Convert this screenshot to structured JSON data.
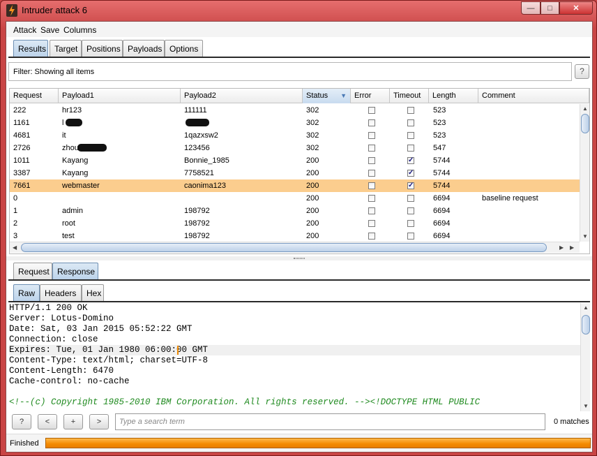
{
  "window": {
    "title": "Intruder attack 6",
    "minimize": "—",
    "maximize": "□",
    "close": "✕"
  },
  "menu": [
    "Attack",
    "Save",
    "Columns"
  ],
  "main_tabs": [
    {
      "label": "Results",
      "active": true
    },
    {
      "label": "Target"
    },
    {
      "label": "Positions"
    },
    {
      "label": "Payloads"
    },
    {
      "label": "Options"
    }
  ],
  "filter": {
    "text": "Filter:  Showing all items",
    "help": "?"
  },
  "table": {
    "columns": [
      "Request",
      "Payload1",
      "Payload2",
      "Status",
      "Error",
      "Timeout",
      "Length",
      "Comment"
    ],
    "sorted_column": "Status",
    "rows": [
      {
        "request": "222",
        "payload1": "hr123",
        "payload2": "111111",
        "status": "302",
        "error": false,
        "timeout": false,
        "length": "523",
        "comment": ""
      },
      {
        "request": "1161",
        "payload1": "l",
        "payload2": "",
        "status": "302",
        "error": false,
        "timeout": false,
        "length": "523",
        "comment": "",
        "redacted": true
      },
      {
        "request": "4681",
        "payload1": "it",
        "payload2": "1qazxsw2",
        "status": "302",
        "error": false,
        "timeout": false,
        "length": "523",
        "comment": ""
      },
      {
        "request": "2726",
        "payload1": "zhou",
        "payload2": "123456",
        "status": "302",
        "error": false,
        "timeout": false,
        "length": "547",
        "comment": "",
        "redacted": true
      },
      {
        "request": "1011",
        "payload1": "Kayang",
        "payload2": "Bonnie_1985",
        "status": "200",
        "error": false,
        "timeout": true,
        "length": "5744",
        "comment": ""
      },
      {
        "request": "3387",
        "payload1": "Kayang",
        "payload2": "7758521",
        "status": "200",
        "error": false,
        "timeout": true,
        "length": "5744",
        "comment": ""
      },
      {
        "request": "7661",
        "payload1": "webmaster",
        "payload2": "caonima123",
        "status": "200",
        "error": false,
        "timeout": true,
        "length": "5744",
        "comment": "",
        "selected": true
      },
      {
        "request": "0",
        "payload1": "",
        "payload2": "",
        "status": "200",
        "error": false,
        "timeout": false,
        "length": "6694",
        "comment": "baseline request"
      },
      {
        "request": "1",
        "payload1": "admin",
        "payload2": "198792",
        "status": "200",
        "error": false,
        "timeout": false,
        "length": "6694",
        "comment": ""
      },
      {
        "request": "2",
        "payload1": "root",
        "payload2": "198792",
        "status": "200",
        "error": false,
        "timeout": false,
        "length": "6694",
        "comment": ""
      },
      {
        "request": "3",
        "payload1": "test",
        "payload2": "198792",
        "status": "200",
        "error": false,
        "timeout": false,
        "length": "6694",
        "comment": ""
      }
    ]
  },
  "detail_tabs": [
    {
      "label": "Request"
    },
    {
      "label": "Response",
      "active": true
    }
  ],
  "view_tabs": [
    {
      "label": "Raw",
      "active": true
    },
    {
      "label": "Headers"
    },
    {
      "label": "Hex"
    }
  ],
  "response_lines": [
    "HTTP/1.1 200 OK",
    "Server: Lotus-Domino",
    "Date: Sat, 03 Jan 2015 05:52:22 GMT",
    "Connection: close",
    "Expires: Tue, 01 Jan 1980 06:00:00 GMT",
    "Content-Type: text/html; charset=UTF-8",
    "Content-Length: 6470",
    "Cache-control: no-cache",
    "",
    "<!--(c) Copyright 1985-2010 IBM Corporation. All rights reserved. --><!DOCTYPE HTML PUBLIC"
  ],
  "search": {
    "help": "?",
    "prev": "<",
    "add": "+",
    "next": ">",
    "placeholder": "Type a search term",
    "matches": "0 matches"
  },
  "status": {
    "text": "Finished",
    "progress": 1.0
  }
}
